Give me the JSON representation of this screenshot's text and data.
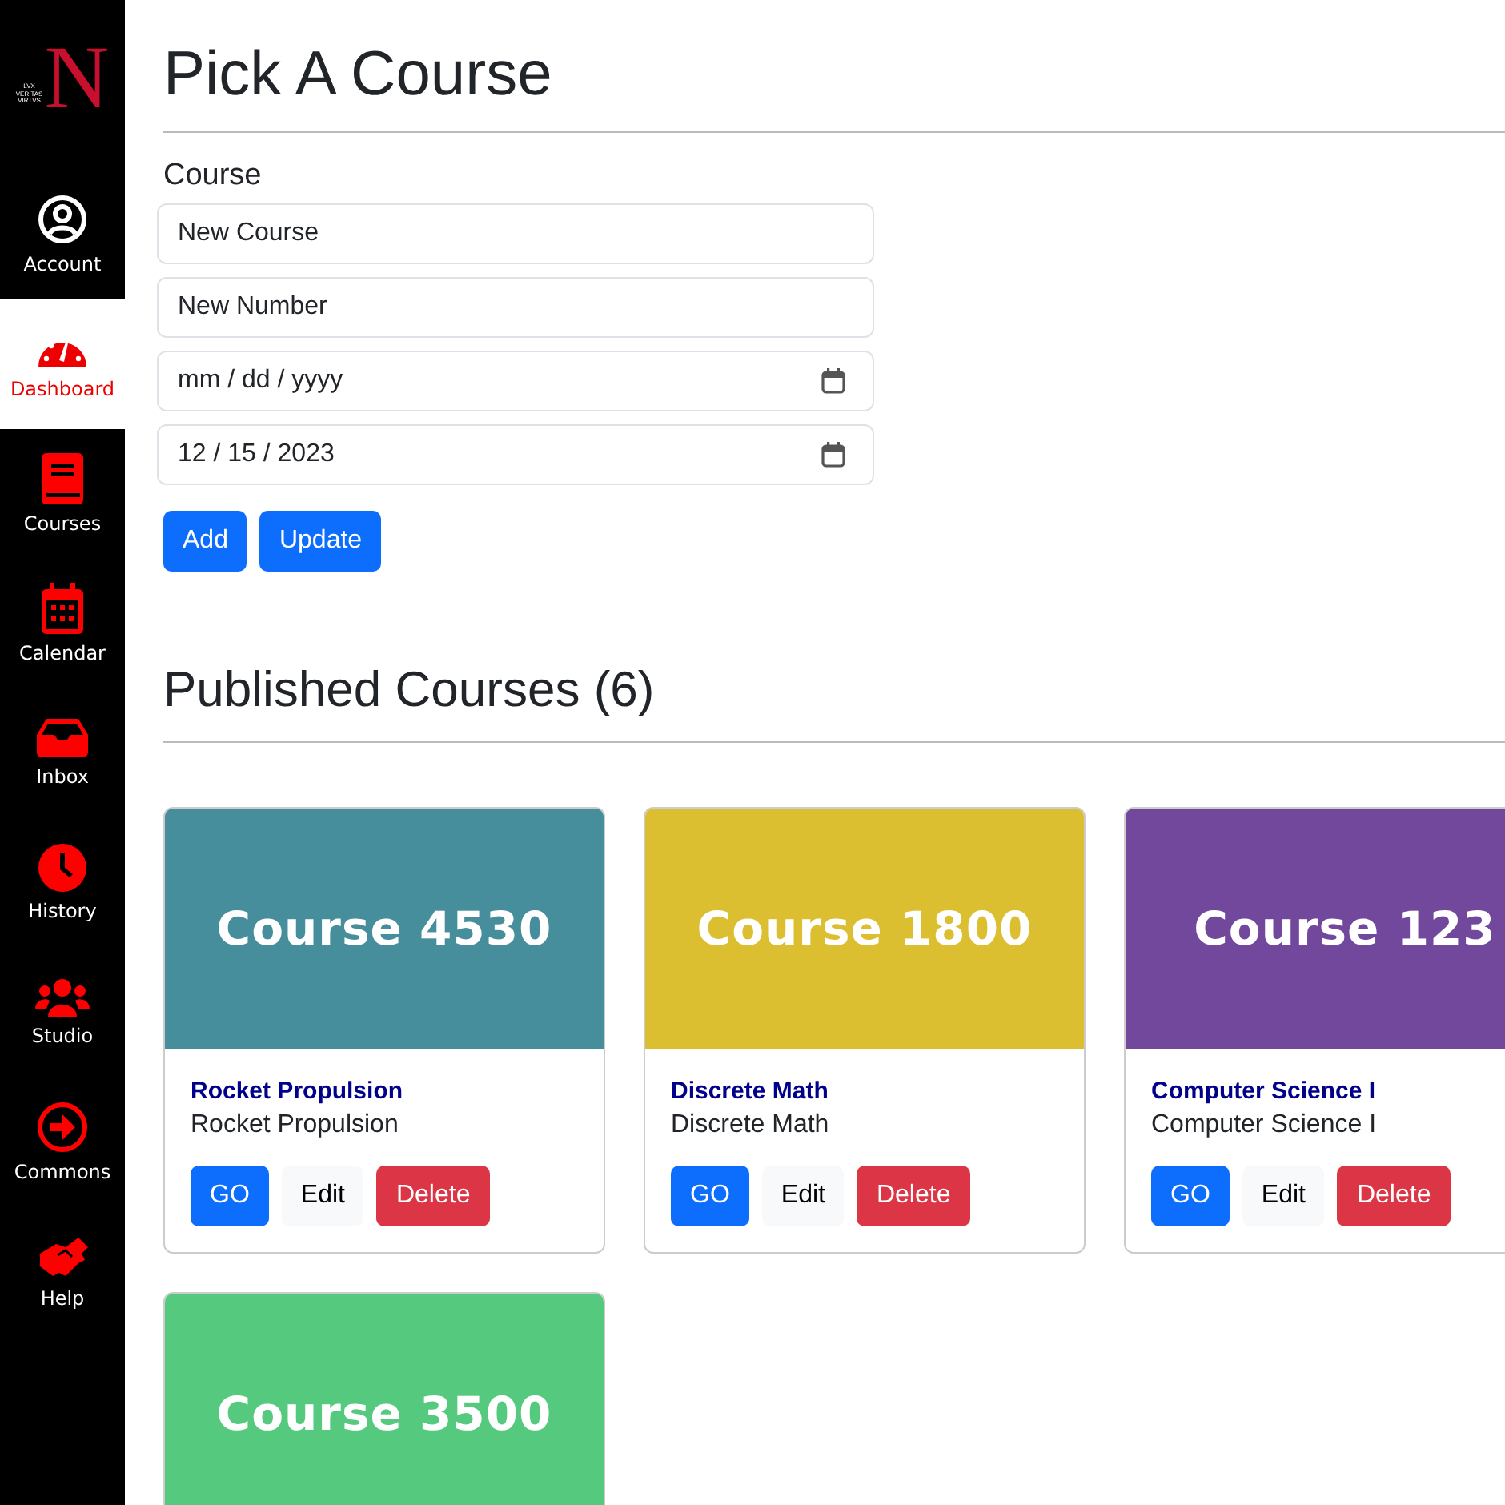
{
  "sidebar": {
    "logo": {
      "letter": "N",
      "motto": [
        "LVX",
        "VERITAS",
        "VIRTVS"
      ]
    },
    "items": [
      {
        "label": "Account",
        "selected": false
      },
      {
        "label": "Dashboard",
        "selected": true
      },
      {
        "label": "Courses",
        "selected": false
      },
      {
        "label": "Calendar",
        "selected": false
      },
      {
        "label": "Inbox",
        "selected": false
      },
      {
        "label": "History",
        "selected": false
      },
      {
        "label": "Studio",
        "selected": false
      },
      {
        "label": "Commons",
        "selected": false
      },
      {
        "label": "Help",
        "selected": false
      }
    ]
  },
  "title": "Pick A Course",
  "form": {
    "label": "Course",
    "fields": [
      {
        "kind": "text",
        "value": "New Course"
      },
      {
        "kind": "text",
        "value": "New Number"
      },
      {
        "kind": "date",
        "placeholder": "mm / dd / yyyy"
      },
      {
        "kind": "date",
        "value": "12 / 15 / 2023"
      }
    ],
    "buttons": [
      "Add",
      "Update"
    ]
  },
  "published": {
    "heading": "Published Courses (6)",
    "cards": [
      {
        "banner": "Course 4530",
        "color": "#468e9b",
        "title": "Rocket Propulsion",
        "subtitle": "Rocket Propulsion",
        "buttons": [
          "GO",
          "Edit",
          "Delete"
        ]
      },
      {
        "banner": "Course 1800",
        "color": "#dcbf31",
        "title": "Discrete Math",
        "subtitle": "Discrete Math",
        "buttons": [
          "GO",
          "Edit",
          "Delete"
        ]
      },
      {
        "banner": "Course 123",
        "color": "#71489c",
        "title": "Computer Science I",
        "subtitle": "Computer Science I",
        "buttons": [
          "GO",
          "Edit",
          "Delete"
        ]
      },
      {
        "banner": "Course 3500",
        "color": "#55c97e"
      }
    ]
  }
}
